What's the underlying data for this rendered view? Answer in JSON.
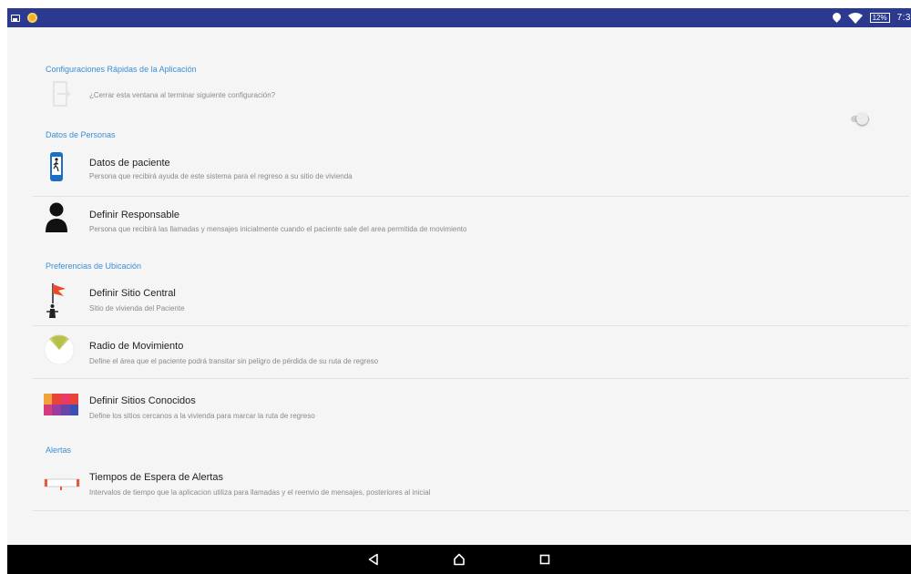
{
  "status_bar": {
    "battery": "12%",
    "time": "7:3",
    "icons": [
      "image-notification-icon",
      "app-notification-icon",
      "location-icon",
      "wifi-icon",
      "battery-icon"
    ]
  },
  "quick_settings": {
    "header": "Configuraciones Rápidas de la Aplicación",
    "close_window_label": "¿Cerrar esta ventana al terminar siguiente configuración?",
    "close_window_toggle": false
  },
  "people": {
    "header": "Datos de Personas",
    "items": [
      {
        "title": "Datos de paciente",
        "subtitle": "Persona que recibirá ayuda de este sistema para el regreso a su sitio de vivienda",
        "icon": "patient-phone-icon"
      },
      {
        "title": "Definir Responsable",
        "subtitle": "Persona que recibirá las llamadas y mensajes inicialmente cuando el paciente sale del area permitida de movimiento",
        "icon": "person-silhouette-icon"
      }
    ]
  },
  "location": {
    "header": "Preferencias de Ubicación",
    "items": [
      {
        "title": "Definir Sitio Central",
        "subtitle": "Sitio de vivienda del Paciente",
        "icon": "flag-home-icon"
      },
      {
        "title": "Radio de Movimiento",
        "subtitle": "Define el área que el paciente podrá transitar sin peligro de pérdida de su ruta de regreso",
        "icon": "radius-pie-icon"
      },
      {
        "title": "Definir Sitios Conocidos",
        "subtitle": "Define los sitios cercanos a la vivienda para marcar la ruta de regreso",
        "icon": "known-places-grid-icon"
      }
    ]
  },
  "alerts": {
    "header": "Alertas",
    "items": [
      {
        "title": "Tiempos de Espera de Alertas",
        "subtitle": "Intervalos de tiempo que la aplicacion utiliza para llamadas y el reenvio de mensajes,  posteriores al inicial",
        "icon": "timer-bar-icon"
      }
    ]
  },
  "nav_bar": {
    "buttons": [
      "back-icon",
      "home-icon",
      "recents-icon"
    ]
  },
  "colors": {
    "status_bar": "#2b3a8f",
    "section_header": "#3a8fd8",
    "background": "#f5f5f5",
    "nav_bar": "#000000"
  }
}
